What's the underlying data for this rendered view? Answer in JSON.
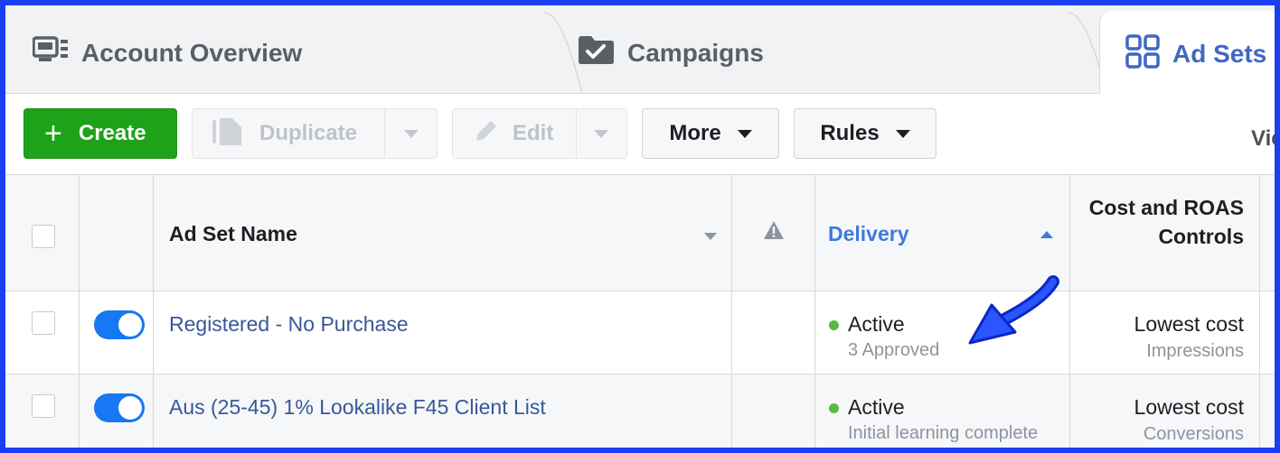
{
  "tabs": {
    "account": "Account Overview",
    "campaigns": "Campaigns",
    "adsets": "Ad Sets"
  },
  "toolbar": {
    "create": "Create",
    "duplicate": "Duplicate",
    "edit": "Edit",
    "more": "More",
    "rules": "Rules",
    "view_partial": "Vie"
  },
  "table": {
    "headers": {
      "name": "Ad Set Name",
      "delivery": "Delivery",
      "cost": "Cost and ROAS Controls"
    },
    "rows": [
      {
        "name": "Registered - No Purchase",
        "status": "Active",
        "substatus": "3 Approved",
        "cost": "Lowest cost",
        "cost_sub": "Impressions"
      },
      {
        "name": "Aus (25-45) 1% Lookalike F45 Client List",
        "status": "Active",
        "substatus": "Initial learning complete",
        "cost": "Lowest cost",
        "cost_sub": "Conversions"
      }
    ]
  },
  "colors": {
    "accent": "#1877f2",
    "create_green": "#1ea21a",
    "active_dot": "#58b947",
    "annotation_arrow": "#1a3ef2"
  }
}
